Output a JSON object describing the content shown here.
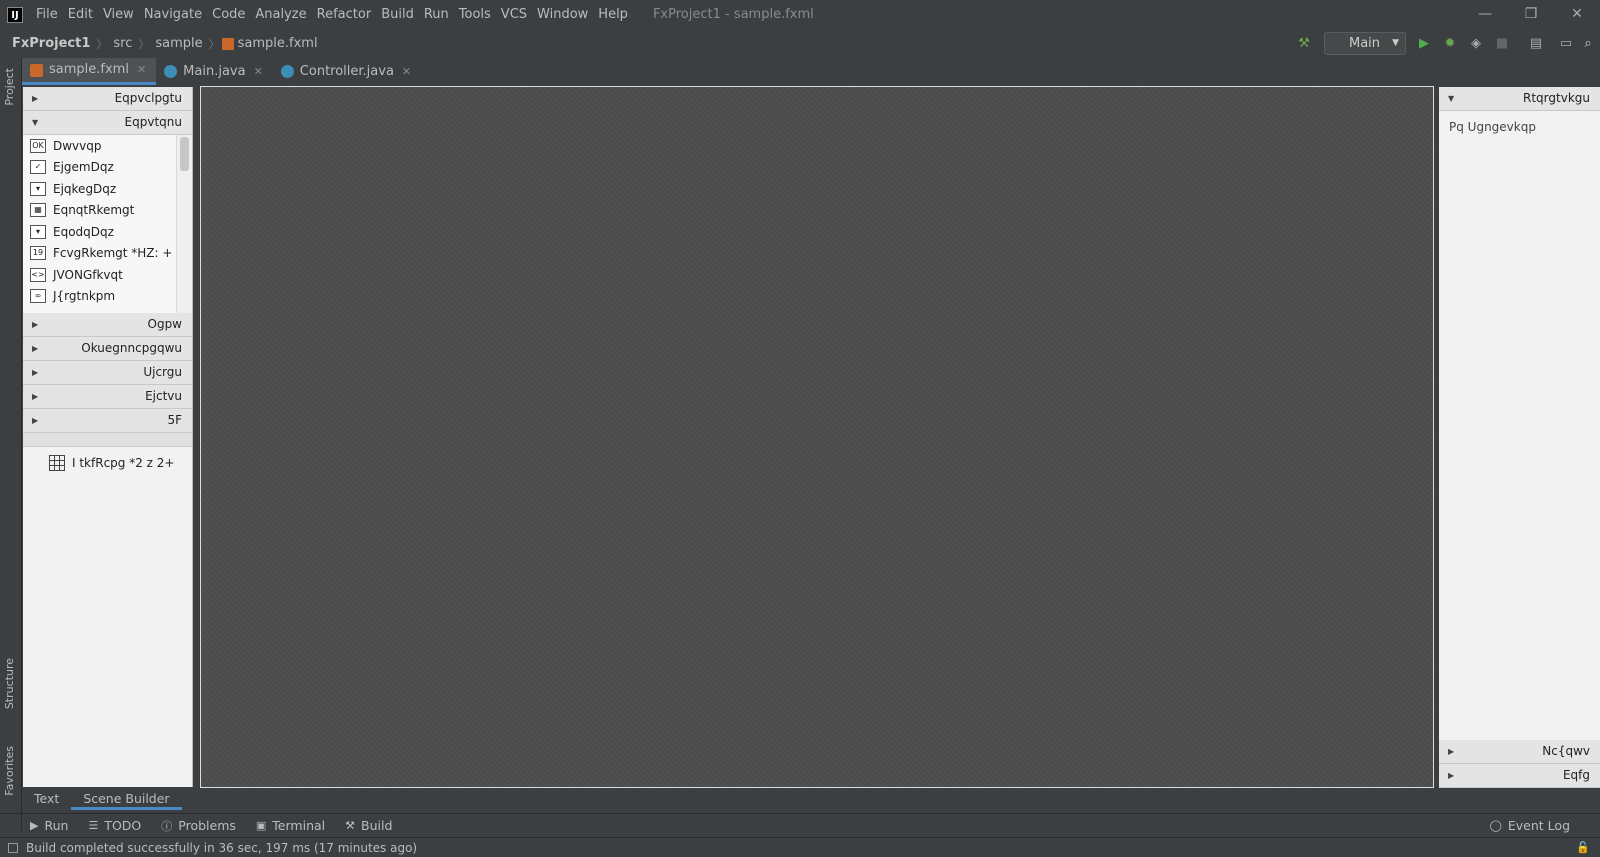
{
  "menubar": {
    "logo": "IJ",
    "items": [
      "File",
      "Edit",
      "View",
      "Navigate",
      "Code",
      "Analyze",
      "Refactor",
      "Build",
      "Run",
      "Tools",
      "VCS",
      "Window",
      "Help"
    ],
    "window_title": "FxProject1 - sample.fxml"
  },
  "window_controls": {
    "minimize": "—",
    "restore": "❐",
    "close": "✕"
  },
  "breadcrumb": {
    "project": "FxProject1",
    "folder1": "src",
    "folder2": "sample",
    "file": "sample.fxml"
  },
  "toolbar": {
    "run_config": "Main"
  },
  "editor_tabs": [
    {
      "label": "sample.fxml",
      "active": true
    },
    {
      "label": "Main.java",
      "active": false
    },
    {
      "label": "Controller.java",
      "active": false
    }
  ],
  "left_strip": {
    "project": "Project",
    "structure": "Structure",
    "favorites": "Favorites"
  },
  "library": {
    "section1": "Eqpvclpgtu",
    "section2": "Eqpvtqnu",
    "controls": [
      {
        "icon": "OK",
        "label": "Dwvvqp"
      },
      {
        "icon": "✓",
        "label": "EjgemDqz"
      },
      {
        "icon": "▾",
        "label": "EjqkegDqz"
      },
      {
        "icon": "▦",
        "label": "EqnqtRkemgt"
      },
      {
        "icon": "▾",
        "label": "EqodqDqz"
      },
      {
        "icon": "19",
        "label": "FcvgRkemgt *HZ: +"
      },
      {
        "icon": "<>",
        "label": "JVONGfkvqt"
      },
      {
        "icon": "∞",
        "label": "J{rgtnkpm"
      }
    ],
    "section3": "Ogpw",
    "section4": "Okuegnncpgqwu",
    "section5": "Ujcrgu",
    "section6": "Ejctvu",
    "section7": "5F"
  },
  "hierarchy": {
    "item": "I tkfRcpg *2 z 2+"
  },
  "inspector": {
    "properties": "Rtqrgtvkgu",
    "none_selected": "Pq Ugngevkqp",
    "layout": "Nc{qwv",
    "code": "Eqfg"
  },
  "bottom_tabs": [
    {
      "label": "Text",
      "active": false
    },
    {
      "label": "Scene Builder",
      "active": true
    }
  ],
  "tool_windows": {
    "run": "Run",
    "todo": "TODO",
    "problems": "Problems",
    "terminal": "Terminal",
    "build": "Build",
    "event_log": "Event Log"
  },
  "status": {
    "message": "Build completed successfully in 36 sec, 197 ms (17 minutes ago)"
  }
}
